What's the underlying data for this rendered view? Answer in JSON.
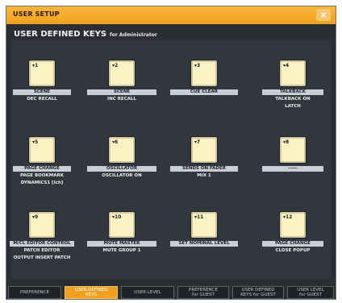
{
  "window": {
    "title": "USER SETUP",
    "close_label": "×"
  },
  "heading": {
    "title": "USER DEFINED KEYS",
    "subtitle": "for Administrator"
  },
  "keys": [
    {
      "num": "1",
      "function": "SCENE",
      "param": "DEC RECALL"
    },
    {
      "num": "2",
      "function": "SCENE",
      "param": "INC RECALL"
    },
    {
      "num": "3",
      "function": "CUE CLEAR",
      "param": ""
    },
    {
      "num": "4",
      "function": "TALKBACK",
      "param": "TALKBACK ON\nLATCH"
    },
    {
      "num": "5",
      "function": "PAGE CHANGE",
      "param": "PAGE BOOKMARK\nDYNAMICS1 [Ich]"
    },
    {
      "num": "6",
      "function": "OSCILLATOR",
      "param": "OSCILLATOR ON"
    },
    {
      "num": "7",
      "function": "SENDS ON FADER",
      "param": "MIX 1"
    },
    {
      "num": "8",
      "function": "-----",
      "param": ""
    },
    {
      "num": "9",
      "function": "M/CL EDITOR CONTROL",
      "param": "PATCH EDITOR\nOUTPUT INSERT PATCH"
    },
    {
      "num": "10",
      "function": "MUTE MASTER",
      "param": "MUTE GROUP 1"
    },
    {
      "num": "11",
      "function": "SET NOMINAL LEVEL",
      "param": ""
    },
    {
      "num": "12",
      "function": "PAGE CHANGE",
      "param": "CLOSE POPUP"
    }
  ],
  "tabs": [
    {
      "label": "PREFERENCE",
      "active": false
    },
    {
      "label": "USER DEFINED\nKEYS",
      "active": true
    },
    {
      "label": "USER LEVEL",
      "active": false
    },
    {
      "label": "PREFERENCE\nfor GUEST",
      "active": false
    },
    {
      "label": "USER DEFINED\nKEYS for GUEST",
      "active": false
    },
    {
      "label": "USER LEVEL\nfor GUEST",
      "active": false
    }
  ]
}
